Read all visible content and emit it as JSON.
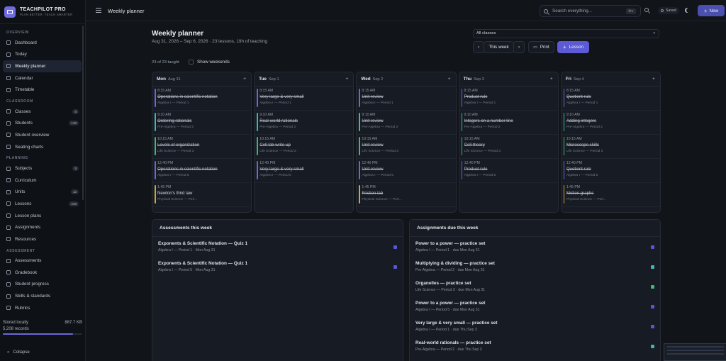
{
  "brand": {
    "name": "TEACHPILOT PRO",
    "tagline": "PLAN BETTER. TEACH SMARTER"
  },
  "nav": [
    {
      "section": "OVERVIEW",
      "items": [
        {
          "label": "Dashboard",
          "icon": "grid-icon"
        },
        {
          "label": "Today",
          "icon": "calendar-day-icon"
        },
        {
          "label": "Weekly planner",
          "icon": "calendar-week-icon",
          "active": true
        },
        {
          "label": "Calendar",
          "icon": "calendar-icon"
        },
        {
          "label": "Timetable",
          "icon": "clock-icon"
        }
      ]
    },
    {
      "section": "CLASSROOM",
      "items": [
        {
          "label": "Classes",
          "icon": "school-icon",
          "badge": "6"
        },
        {
          "label": "Students",
          "icon": "users-icon",
          "badge": "136"
        },
        {
          "label": "Student overview",
          "icon": "user-icon"
        },
        {
          "label": "Seating charts",
          "icon": "seat-icon"
        }
      ]
    },
    {
      "section": "PLANNING",
      "items": [
        {
          "label": "Subjects",
          "icon": "book-icon",
          "badge": "5"
        },
        {
          "label": "Curriculum",
          "icon": "layers-icon"
        },
        {
          "label": "Units",
          "icon": "folder-icon",
          "badge": "12"
        },
        {
          "label": "Lessons",
          "icon": "lesson-icon",
          "badge": "236"
        },
        {
          "label": "Lesson plans",
          "icon": "clipboard-icon"
        },
        {
          "label": "Assignments",
          "icon": "file-icon"
        },
        {
          "label": "Resources",
          "icon": "box-icon"
        }
      ]
    },
    {
      "section": "ASSESSMENT",
      "items": [
        {
          "label": "Assessments",
          "icon": "check-icon"
        },
        {
          "label": "Gradebook",
          "icon": "gradebook-icon"
        },
        {
          "label": "Student progress",
          "icon": "chart-icon"
        },
        {
          "label": "Skills & standards",
          "icon": "target-icon"
        },
        {
          "label": "Rubrics",
          "icon": "rubric-icon"
        }
      ]
    }
  ],
  "storage": {
    "label": "Stored locally",
    "size": "887.7 KB",
    "records": "5,208 records",
    "fill": 0.88
  },
  "collapse_label": "Collapse",
  "topbar": {
    "title": "Weekly planner",
    "search_placeholder": "Search everything...",
    "kbd": "⌘K",
    "saved": "Saved",
    "new_label": "New"
  },
  "page": {
    "title": "Weekly planner",
    "subtitle": "Aug 31, 2026 – Sep 6, 2026 · 23 lessons, 19h of teaching",
    "class_filter": "All classes",
    "this_week": "This week",
    "print": "Print",
    "lesson": "Lesson",
    "taught": "23 of 23 taught",
    "show_weekends": "Show weekends"
  },
  "days": [
    {
      "day": "Mon",
      "date": "Aug 31",
      "slots": [
        {
          "time": "8:15 AM",
          "name": "Operations in scientific notation",
          "sub": "Algebra I — Period 1",
          "color": "#6b69d8"
        },
        {
          "time": "9:10 AM",
          "name": "Ordering rationals",
          "sub": "Pre-Algebra — Period 2",
          "color": "#3fb6b0"
        },
        {
          "time": "10:15 AM",
          "name": "Levels of organization",
          "sub": "Life Science — Period 3",
          "color": "#3fb67a"
        },
        {
          "time": "12:40 PM",
          "name": "Operations in scientific notation",
          "sub": "Algebra I — Period 5",
          "color": "#6b69d8"
        },
        {
          "time": "1:45 PM",
          "name": "Newton's third law",
          "sub": "Physical Science — Peri...",
          "color": "#d4a43a",
          "open": true
        }
      ]
    },
    {
      "day": "Tue",
      "date": "Sep 1",
      "slots": [
        {
          "time": "8:15 AM",
          "name": "Very large & very small",
          "sub": "Algebra I — Period 1",
          "color": "#6b69d8"
        },
        {
          "time": "9:10 AM",
          "name": "Real-world rationals",
          "sub": "Pre-Algebra — Period 2",
          "color": "#3fb6b0"
        },
        {
          "time": "10:15 AM",
          "name": "Cell lab write-up",
          "sub": "Life Science — Period 3",
          "color": "#3fb67a"
        },
        {
          "time": "12:40 PM",
          "name": "Very large & very small",
          "sub": "Algebra I — Period 5",
          "color": "#6b69d8"
        }
      ]
    },
    {
      "day": "Wed",
      "date": "Sep 2",
      "slots": [
        {
          "time": "8:15 AM",
          "name": "Unit review",
          "sub": "Algebra I — Period 1",
          "color": "#6b69d8"
        },
        {
          "time": "9:10 AM",
          "name": "Unit review",
          "sub": "Pre-Algebra — Period 2",
          "color": "#3fb6b0"
        },
        {
          "time": "10:15 AM",
          "name": "Unit review",
          "sub": "Life Science — Period 3",
          "color": "#3fb67a"
        },
        {
          "time": "12:40 PM",
          "name": "Unit review",
          "sub": "Algebra I — Period 5",
          "color": "#6b69d8"
        },
        {
          "time": "1:45 PM",
          "name": "Friction lab",
          "sub": "Physical Science — Peri...",
          "color": "#d4a43a"
        }
      ]
    },
    {
      "day": "Thu",
      "date": "Sep 3",
      "slots": [
        {
          "time": "8:15 AM",
          "name": "Product rule",
          "sub": "Algebra I — Period 1",
          "color": "#6b69d8"
        },
        {
          "time": "9:10 AM",
          "name": "Integers on a number line",
          "sub": "Pre-Algebra — Period 2",
          "color": "#3fb6b0"
        },
        {
          "time": "10:15 AM",
          "name": "Cell theory",
          "sub": "Life Science — Period 3",
          "color": "#3fb67a"
        },
        {
          "time": "12:40 PM",
          "name": "Product rule",
          "sub": "Algebra I — Period 5",
          "color": "#6b69d8"
        }
      ]
    },
    {
      "day": "Fri",
      "date": "Sep 4",
      "slots": [
        {
          "time": "8:15 AM",
          "name": "Quotient rule",
          "sub": "Algebra I — Period 1",
          "color": "#6b69d8"
        },
        {
          "time": "9:10 AM",
          "name": "Adding integers",
          "sub": "Pre-Algebra — Period 2",
          "color": "#3fb6b0"
        },
        {
          "time": "10:15 AM",
          "name": "Microscope skills",
          "sub": "Life Science — Period 3",
          "color": "#3fb67a"
        },
        {
          "time": "12:40 PM",
          "name": "Quotient rule",
          "sub": "Algebra I — Period 5",
          "color": "#6b69d8"
        },
        {
          "time": "1:45 PM",
          "name": "Motion graphs",
          "sub": "Physical Science — Peri...",
          "color": "#d4a43a"
        }
      ]
    }
  ],
  "assessments": {
    "title": "Assessments this week",
    "items": [
      {
        "name": "Exponents & Scientific Notation — Quiz 1",
        "meta": "Algebra I — Period 1 · Mon Aug 31",
        "color": "#5a57d6"
      },
      {
        "name": "Exponents & Scientific Notation — Quiz 1",
        "meta": "Algebra I — Period 5 · Mon Aug 31",
        "color": "#5a57d6"
      }
    ]
  },
  "assignments": {
    "title": "Assignments due this week",
    "items": [
      {
        "name": "Power to a power — practice set",
        "meta": "Algebra I — Period 1 · due Mon Aug 31",
        "color": "#5a57d6"
      },
      {
        "name": "Multiplying & dividing — practice set",
        "meta": "Pre-Algebra — Period 2 · due Mon Aug 31",
        "color": "#3fb6b0"
      },
      {
        "name": "Organelles — practice set",
        "meta": "Life Science — Period 3 · due Mon Aug 31",
        "color": "#3fb67a"
      },
      {
        "name": "Power to a power — practice set",
        "meta": "Algebra I — Period 5 · due Mon Aug 31",
        "color": "#5a57d6"
      },
      {
        "name": "Very large & very small — practice set",
        "meta": "Algebra I — Period 1 · due Thu Sep 3",
        "color": "#5a57d6"
      },
      {
        "name": "Real-world rationals — practice set",
        "meta": "Pre-Algebra — Period 2 · due Thu Sep 3",
        "color": "#3fb6b0"
      }
    ]
  }
}
